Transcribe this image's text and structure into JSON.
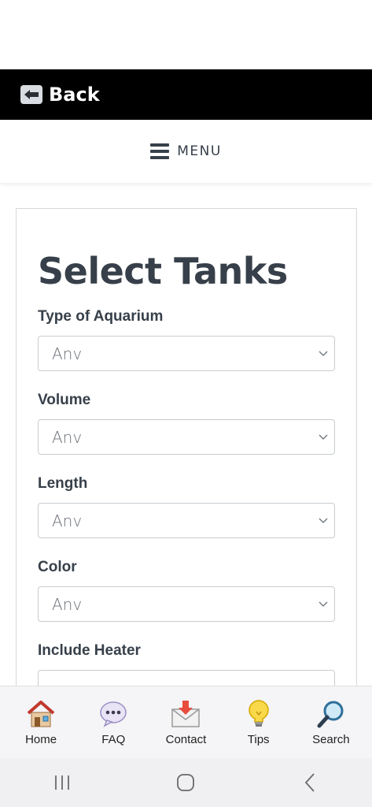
{
  "header": {
    "back_label": "Back",
    "menu_label": "MENU"
  },
  "page": {
    "title": "Select Tanks"
  },
  "fields": [
    {
      "label": "Type of Aquarium",
      "value": "Anv"
    },
    {
      "label": "Volume",
      "value": "Anv"
    },
    {
      "label": "Length",
      "value": "Anv"
    },
    {
      "label": "Color",
      "value": "Anv"
    },
    {
      "label": "Include Heater",
      "value": ""
    }
  ],
  "bottom_nav": [
    {
      "label": "Home",
      "icon": "house-icon"
    },
    {
      "label": "FAQ",
      "icon": "speech-bubble-icon"
    },
    {
      "label": "Contact",
      "icon": "envelope-icon"
    },
    {
      "label": "Tips",
      "icon": "lightbulb-icon"
    },
    {
      "label": "Search",
      "icon": "magnifier-icon"
    }
  ],
  "colors": {
    "header_bg": "#000000",
    "text": "#37404a",
    "border": "#d6d8db"
  }
}
